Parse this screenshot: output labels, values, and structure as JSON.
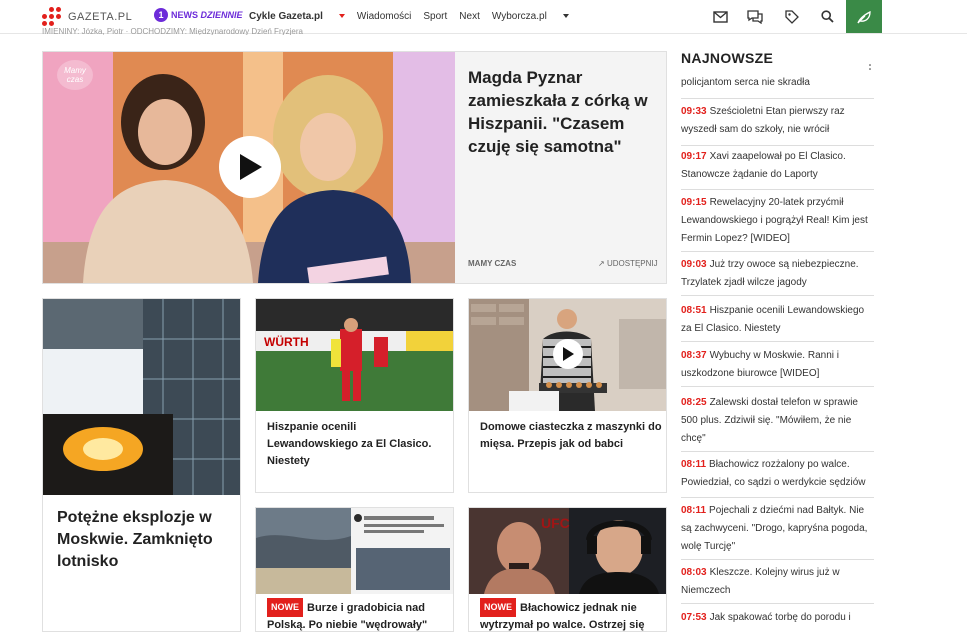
{
  "header": {
    "logo_text": "GAZETA.PL",
    "news_badge": {
      "number": "1",
      "label": "NEWS",
      "label_em": "DZIENNIE"
    },
    "nav": [
      {
        "label": "Cykle Gazeta.pl",
        "bold": true,
        "caret": "red"
      },
      {
        "label": "Wiadomości"
      },
      {
        "label": "Sport"
      },
      {
        "label": "Next"
      },
      {
        "label": "Wyborcza.pl",
        "caret": "dark"
      }
    ],
    "icons": [
      "mail-icon",
      "comments-icon",
      "tag-icon",
      "search-icon",
      "leaf-icon"
    ],
    "eco_color": "#3a8a47"
  },
  "breadcrumb": "IMIENINY: Józka, Piotr · ODCHODZIMY: Międzynarodowy Dzień Fryzjera",
  "hero": {
    "title": "Magda Pyznar zamieszkała z córką w Hiszpanii. \"Czasem czuję się samotna\"",
    "source": "MAMY CZAS",
    "share": "UDOSTĘPNIJ",
    "watermark": "Mamy czas"
  },
  "cards": [
    {
      "title": "Potężne eksplozje w Moskwie. Zamknięto lotnisko",
      "nowe": false
    },
    {
      "title": "Hiszpanie ocenili Lewandowskiego za El Clasico. Niestety",
      "nowe": false,
      "banner": "WÜRTH"
    },
    {
      "title": "Domowe ciasteczka z maszynki do mięsa. Przepis jak od babci",
      "nowe": false
    },
    {
      "title": "Burze i gradobicia nad Polską. Po niebie \"wędrowały\"",
      "nowe": true,
      "nowe_label": "NOWE"
    },
    {
      "title": "Błachowicz jednak nie wytrzymał po walce. Ostrzej się",
      "nowe": true,
      "nowe_label": "NOWE"
    }
  ],
  "sidebar": {
    "title": "NAJNOWSZE",
    "items": [
      {
        "time": "",
        "text": "policjantom serca nie skradła"
      },
      {
        "time": "09:33",
        "text": "Sześcioletni Etan pierwszy raz wyszedł sam do szkoły, nie wrócił"
      },
      {
        "time": "09:17",
        "text": "Xavi zaapelował po El Clasico. Stanowcze żądanie do Laporty"
      },
      {
        "time": "09:15",
        "text": "Rewelacyjny 20-latek przyćmił Lewandowskiego i pogrążył Real! Kim jest Fermin Lopez? [WIDEO]"
      },
      {
        "time": "09:03",
        "text": "Już trzy owoce są niebezpieczne. Trzylatek zjadł wilcze jagody"
      },
      {
        "time": "08:51",
        "text": "Hiszpanie ocenili Lewandowskiego za El Clasico. Niestety"
      },
      {
        "time": "08:37",
        "text": "Wybuchy w Moskwie. Ranni i uszkodzone biurowce [WIDEO]"
      },
      {
        "time": "08:25",
        "text": "Zalewski dostał telefon w sprawie 500 plus. Zdziwił się. \"Mówiłem, że nie chcę\""
      },
      {
        "time": "08:11",
        "text": "Błachowicz rozżalony po walce. Powiedział, co sądzi o werdykcie sędziów"
      },
      {
        "time": "08:11",
        "text": "Pojechali z dziećmi nad Bałtyk. Nie są zachwyceni. \"Drogo, kapryśna pogoda, wolę Turcję\""
      },
      {
        "time": "08:03",
        "text": "Kleszcze. Kolejny wirus już w Niemczech"
      },
      {
        "time": "07:53",
        "text": "Jak spakować torbę do porodu i"
      }
    ]
  },
  "colors": {
    "accent": "#e2201c",
    "news": "#6c2bd9"
  }
}
